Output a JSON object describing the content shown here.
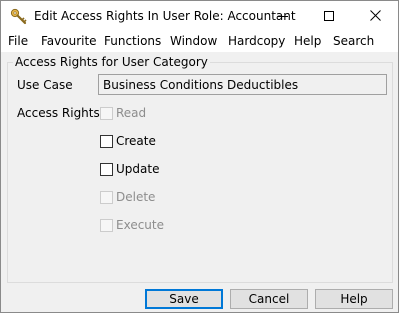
{
  "window": {
    "title": "Edit Access Rights In User Role: Accountant"
  },
  "menu": [
    "File",
    "Favourite",
    "Functions",
    "Window",
    "Hardcopy",
    "Help",
    "Search"
  ],
  "group": {
    "legend": "Access Rights for User Category",
    "use_case_label": "Use Case",
    "use_case_value": "Business Conditions Deductibles",
    "access_rights_label": "Access Rights",
    "rights": [
      {
        "label": "Read",
        "checked": false,
        "enabled": false
      },
      {
        "label": "Create",
        "checked": false,
        "enabled": true
      },
      {
        "label": "Update",
        "checked": false,
        "enabled": true
      },
      {
        "label": "Delete",
        "checked": false,
        "enabled": false
      },
      {
        "label": "Execute",
        "checked": false,
        "enabled": false
      }
    ]
  },
  "buttons": {
    "save": "Save",
    "cancel": "Cancel",
    "help": "Help"
  },
  "icons": {
    "app": "key-icon",
    "minimize": "minimize-icon",
    "maximize": "maximize-icon",
    "close": "close-icon"
  }
}
